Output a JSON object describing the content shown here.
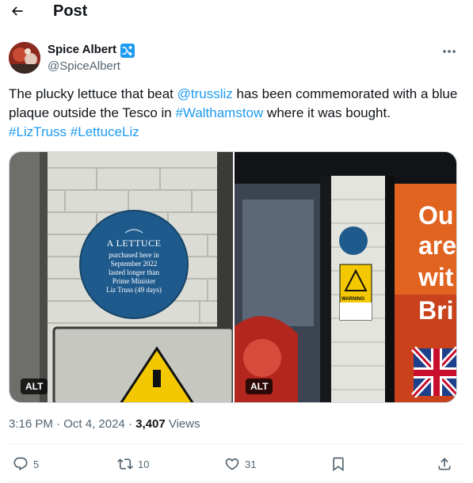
{
  "header": {
    "title": "Post",
    "back_icon": "arrow-left-icon"
  },
  "author": {
    "display_name": "Spice Albert",
    "handle": "@SpiceAlbert",
    "verified_icon": "shuffle-badge-icon",
    "avatar_icon": "avatar"
  },
  "tweet": {
    "text_1": "The plucky lettuce that beat ",
    "mention": "@trussliz",
    "text_2": " has been commemorated with a blue plaque outside the Tesco in ",
    "hashtag_place": "#Walthamstow",
    "text_3": " where it was bought.",
    "hashtag_1": "#LizTruss",
    "hashtag_2": "#LettuceLiz"
  },
  "media": {
    "alt_label": "ALT",
    "plaque": {
      "title": "A LETTUCE",
      "lines": [
        "purchased here in",
        "September 2022",
        "lasted longer than",
        "Prime Minister",
        "Liz Truss (49 days)"
      ]
    },
    "shop_sign": [
      "Ou",
      "are",
      "wit",
      "Bri"
    ],
    "warning_sign": "WARNING"
  },
  "meta": {
    "time": "3:16 PM",
    "separator": "·",
    "date": "Oct 4, 2024",
    "views_count": "3,407",
    "views_label": "Views"
  },
  "actions": {
    "replies": "5",
    "reposts": "10",
    "likes": "31"
  },
  "colors": {
    "link": "#1d9bf0",
    "muted": "#536471",
    "text": "#0f1419",
    "plaque_blue": "#1e5a8c"
  }
}
